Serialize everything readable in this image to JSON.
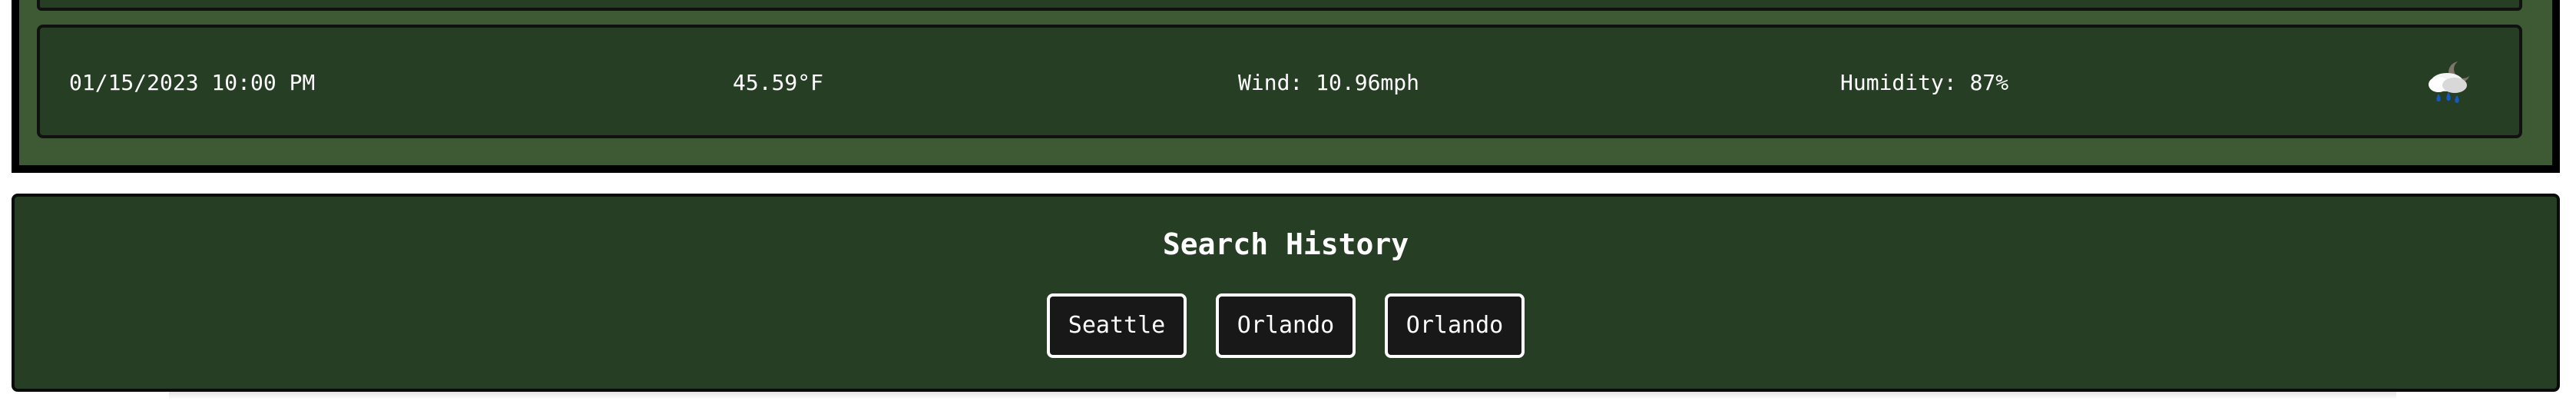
{
  "forecast": {
    "rows": [
      {
        "date": "01/15/2023 10:00 PM",
        "temperature": "45.59°F",
        "wind": "Wind: 10.96mph",
        "humidity": "Humidity: 87%",
        "icon": "rain-cloud-moon-icon"
      }
    ]
  },
  "search_history": {
    "title": "Search History",
    "items": [
      {
        "label": "Seattle"
      },
      {
        "label": "Orlando"
      },
      {
        "label": "Orlando"
      }
    ]
  },
  "colors": {
    "panel_green": "#3d5a35",
    "card_green": "#263f24",
    "border_black": "#111111",
    "button_background": "#181818",
    "text": "#ffffff"
  }
}
